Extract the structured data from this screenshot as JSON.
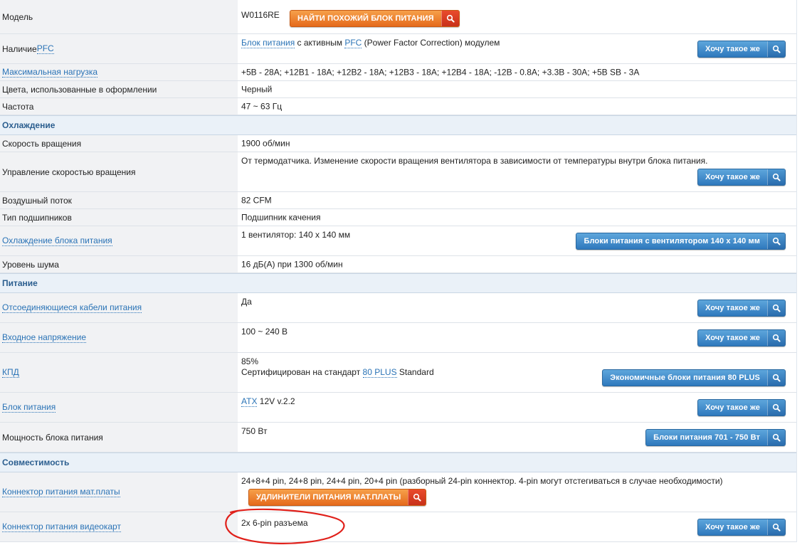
{
  "colors": {
    "link": "#2a73b6",
    "section_bg": "#eaf1f8",
    "label_bg": "#f1f2f4",
    "button_blue": "#2f79bd",
    "button_orange": "#e56a1c",
    "annotation": "#e0201a"
  },
  "model": {
    "label": "Модель",
    "value": "W0116RE",
    "button": "НАЙТИ ПОХОЖИЙ БЛОК ПИТАНИЯ"
  },
  "pfc": {
    "label_pre": "Наличие ",
    "label_link": "PFC",
    "val_link1": "Блок питания",
    "val_mid": " с активным ",
    "val_link2": "PFC",
    "val_post": " (Power Factor Correction) модулем",
    "button": "Хочу такое же"
  },
  "max_load": {
    "label": "Максимальная нагрузка",
    "value": "+5В - 28А; +12В1 - 18А; +12В2 - 18А; +12В3 - 18А; +12В4 - 18А; -12В - 0.8А; +3.3В - 30А; +5В SB - 3А"
  },
  "colors_row": {
    "label": "Цвета, использованные в оформлении",
    "value": "Черный"
  },
  "freq": {
    "label": "Частота",
    "value": "47 ~ 63 Гц"
  },
  "sec_cooling": "Охлаждение",
  "rpm": {
    "label": "Скорость вращения",
    "value": "1900 об/мин"
  },
  "speed_ctrl": {
    "label": "Управление скоростью вращения",
    "value": "От термодатчика. Изменение скорости вращения вентилятора в зависимости от температуры внутри блока питания.",
    "button": "Хочу такое же"
  },
  "airflow": {
    "label": "Воздушный поток",
    "value": "82 CFM"
  },
  "bearing": {
    "label": "Тип подшипников",
    "value": "Подшипник качения"
  },
  "psu_cooling": {
    "label": "Охлаждение блока питания",
    "value": "1 вентилятор: 140 x 140 мм",
    "button": "Блоки питания с вентилятором 140 x 140 мм"
  },
  "noise": {
    "label": "Уровень шума",
    "value": "16 дБ(А) при 1300 об/мин"
  },
  "sec_power": "Питание",
  "detach": {
    "label": "Отсоединяющиеся кабели питания",
    "value": "Да",
    "button": "Хочу такое же"
  },
  "input_v": {
    "label": "Входное напряжение",
    "value": "100 ~ 240 В",
    "button": "Хочу такое же"
  },
  "eff": {
    "label": "КПД",
    "value1": "85%",
    "value2_pre": "Сертифицирован на стандарт ",
    "value2_link": "80 PLUS",
    "value2_post": " Standard",
    "button": "Экономичные блоки питания 80 PLUS"
  },
  "psu_std": {
    "label": "Блок питания",
    "val_link": "ATX",
    "val_post": " 12V v.2.2",
    "button": "Хочу такое же"
  },
  "power": {
    "label": "Мощность блока питания",
    "value": "750 Вт",
    "button": "Блоки питания 701 - 750 Вт"
  },
  "sec_compat": "Совместимость",
  "mb_conn": {
    "label": "Коннектор питания мат.платы",
    "value": "24+8+4 pin, 24+8 pin, 24+4 pin, 20+4 pin (разборный 24-pin коннектор. 4-pin могут отстегиваться в случае необходимости)",
    "button": "УДЛИНИТЕЛИ ПИТАНИЯ МАТ.ПЛАТЫ"
  },
  "gpu_conn": {
    "label": "Коннектор питания видеокарт",
    "value": "2x 6-pin разъема",
    "button": "Хочу такое же"
  }
}
